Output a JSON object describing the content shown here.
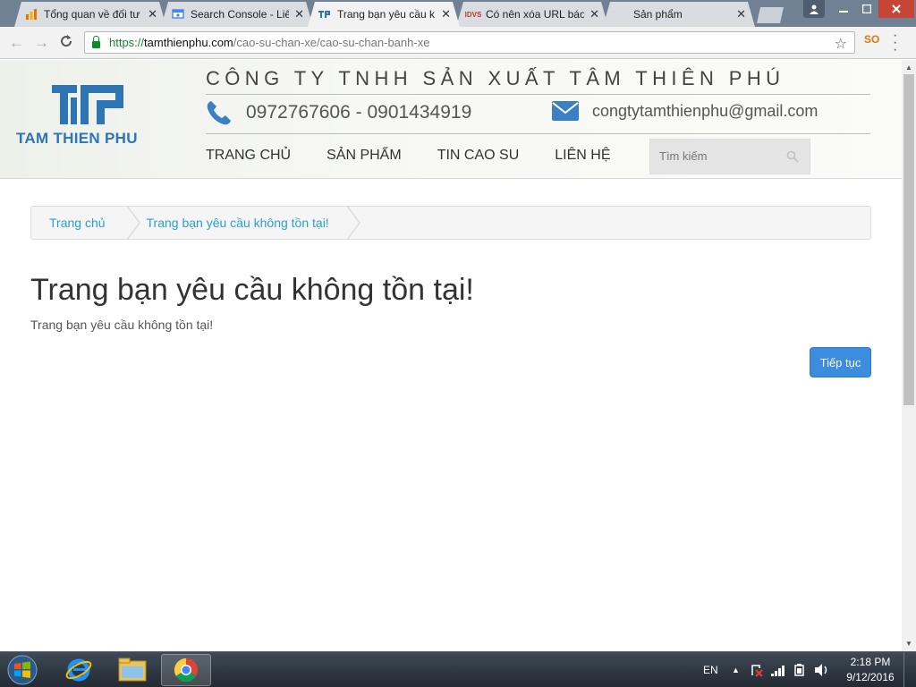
{
  "browser": {
    "tabs": [
      {
        "title": "Tổng quan về đối tư",
        "favicon": "analytics-icon",
        "active": false
      },
      {
        "title": "Search Console - Liê",
        "favicon": "search-console-icon",
        "active": false
      },
      {
        "title": "Trang bạn yêu cầu k",
        "favicon": "site-logo-icon",
        "active": true
      },
      {
        "title": "Có nên xóa URL báo",
        "favicon": "idvs-icon",
        "favicon_text": "IDVS",
        "active": false
      },
      {
        "title": "Sản phẩm",
        "favicon": "",
        "active": false
      }
    ],
    "address": {
      "scheme": "https://",
      "host": "tamthienphu.com",
      "path": "/cao-su-chan-xe/cao-su-chan-banh-xe"
    },
    "extension_badge": "SO",
    "colors": {
      "secure": "#118a2c",
      "frame": "#6f8193"
    }
  },
  "site": {
    "logo_text": "TAM THIEN PHU",
    "company_name": "CÔNG TY TNHH SẢN XUẤT TÂM THIÊN PHÚ",
    "phone": "0972767606 - 0901434919",
    "email": "congtytamthienphu@gmail.com",
    "nav": [
      {
        "label": "TRANG CHỦ"
      },
      {
        "label": "SẢN PHẨM"
      },
      {
        "label": "TIN CAO SU"
      },
      {
        "label": "LIÊN HỆ"
      }
    ],
    "search_placeholder": "Tìm kiếm",
    "colors": {
      "brand": "#2e75b6",
      "link": "#2a9fd6",
      "button": "#3c8dde"
    }
  },
  "content": {
    "breadcrumb": [
      {
        "label": "Trang chủ"
      },
      {
        "label": "Trang bạn yêu cầu không tồn tại!"
      }
    ],
    "heading": "Trang bạn yêu cầu không tồn tại!",
    "text": "Trang bạn yêu cầu không tồn tại!",
    "continue_label": "Tiếp tục"
  },
  "taskbar": {
    "apps": [
      {
        "name": "internet-explorer"
      },
      {
        "name": "file-explorer"
      },
      {
        "name": "chrome",
        "active": true
      }
    ],
    "language": "EN",
    "time": "2:18 PM",
    "date": "9/12/2016"
  }
}
